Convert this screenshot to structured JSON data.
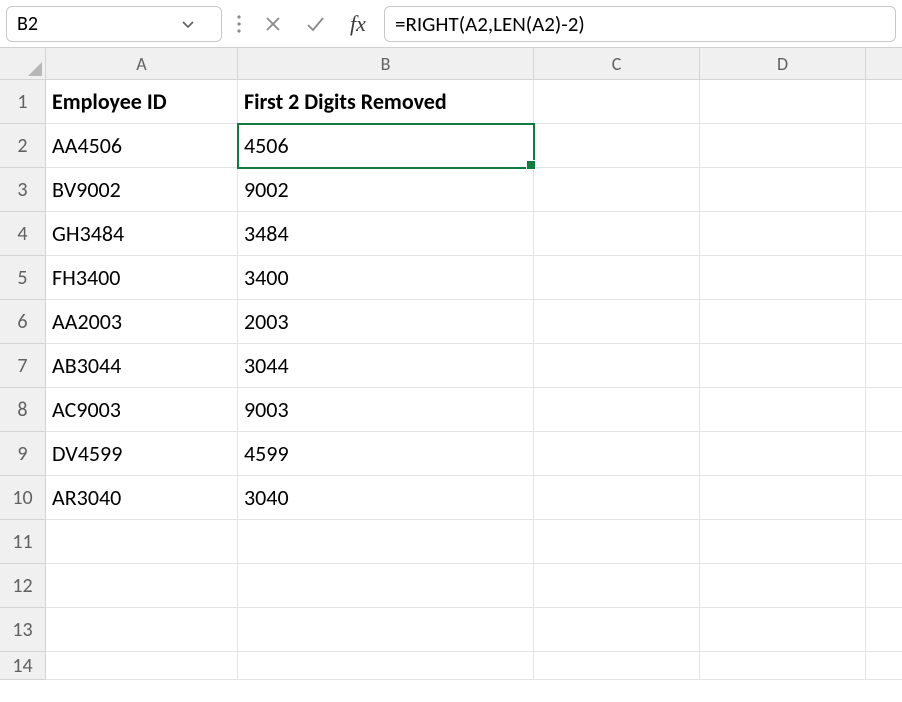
{
  "formulaBar": {
    "nameBox": "B2",
    "formula": "=RIGHT(A2,LEN(A2)-2)",
    "fxLabel": "fx"
  },
  "columns": [
    "A",
    "B",
    "C",
    "D",
    ""
  ],
  "rowNumbers": [
    "1",
    "2",
    "3",
    "4",
    "5",
    "6",
    "7",
    "8",
    "9",
    "10",
    "11",
    "12",
    "13",
    "14"
  ],
  "headers": {
    "A": "Employee ID",
    "B": "First 2 Digits Removed"
  },
  "rows": [
    {
      "A": "AA4506",
      "B": "4506"
    },
    {
      "A": "BV9002",
      "B": "9002"
    },
    {
      "A": "GH3484",
      "B": "3484"
    },
    {
      "A": "FH3400",
      "B": "3400"
    },
    {
      "A": "AA2003",
      "B": "2003"
    },
    {
      "A": "AB3044",
      "B": "3044"
    },
    {
      "A": "AC9003",
      "B": "9003"
    },
    {
      "A": "DV4599",
      "B": "4599"
    },
    {
      "A": "AR3040",
      "B": "3040"
    }
  ],
  "selectedCell": "B2"
}
